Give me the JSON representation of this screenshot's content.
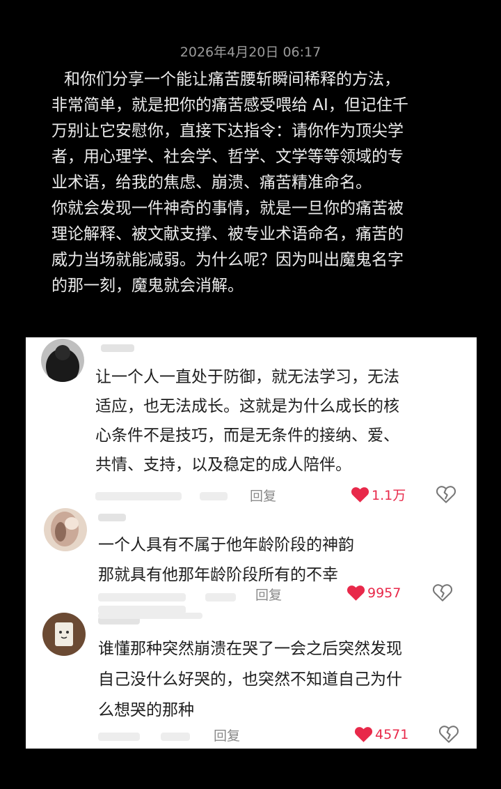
{
  "post": {
    "timestamp": "2026年4月20日 06:17",
    "paragraph_1_lines": [
      "和你们分享一个能让痛苦腰斩瞬间稀释的方法，",
      "非常简单，就是把你的痛苦感受喂给 AI，但记住千",
      "万别让它安慰你，直接下达指令：请你作为顶尖学",
      "者，用心理学、社会学、哲学、文学等等领域的专",
      "业术语，给我的焦虑、崩溃、痛苦精准命名。"
    ],
    "paragraph_2_lines": [
      "你就会发现一件神奇的事情，就是一旦你的痛苦被",
      "理论解释、被文献支撑、被专业术语命名，痛苦的",
      "威力当场就能减弱。为什么呢？因为叫出魔鬼名字",
      "的那一刻，魔鬼就会消解。"
    ]
  },
  "comments": [
    {
      "avatar_icon": "avatar-dark-figure",
      "text_lines": [
        "让一个人一直处于防御，就无法学习，无法",
        "适应，也无法成长。这就是为什么成长的核",
        "心条件不是技巧，而是无条件的接纳、爱、",
        "共情、支持，以及稳定的成人陪伴。"
      ],
      "reply_label": "回复",
      "like_count": "1.1万",
      "like_icon": "heart-filled-icon",
      "dislike_icon": "broken-heart-icon"
    },
    {
      "avatar_icon": "avatar-blurred-person",
      "text_lines": [
        "一个人具有不属于他年龄阶段的神韵",
        "那就具有他那年龄阶段所有的不幸"
      ],
      "reply_label": "回复",
      "like_count": "9957",
      "like_icon": "heart-filled-icon",
      "dislike_icon": "broken-heart-icon"
    },
    {
      "avatar_icon": "avatar-cartoon-block",
      "text_lines": [
        "谁懂那种突然崩溃在哭了一会之后突然发现",
        "自己没什么好哭的，也突然不知道自己为什",
        "么想哭的那种"
      ],
      "reply_label": "回复",
      "like_count": "4571",
      "like_icon": "heart-filled-icon",
      "dislike_icon": "broken-heart-icon"
    }
  ],
  "colors": {
    "background": "#000000",
    "post_text": "#ececec",
    "timestamp": "#9b9b9b",
    "comment_text": "#1e1e1e",
    "like_red": "#e8294a",
    "muted": "#888888"
  }
}
